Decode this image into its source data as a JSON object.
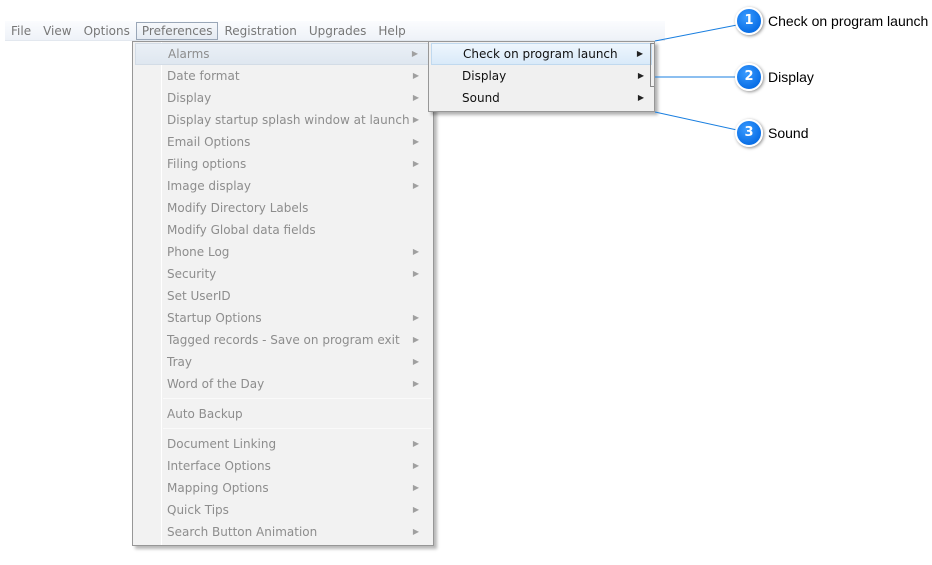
{
  "menubar": {
    "items": [
      "File",
      "View",
      "Options",
      "Preferences",
      "Registration",
      "Upgrades",
      "Help"
    ],
    "active": "Preferences"
  },
  "dropdown": {
    "groups": [
      [
        {
          "label": "Alarms",
          "submenu": true,
          "highlighted": true
        },
        {
          "label": "Date format",
          "submenu": true
        },
        {
          "label": "Display",
          "submenu": true
        },
        {
          "label": "Display startup splash window at launch",
          "submenu": true
        },
        {
          "label": "Email Options",
          "submenu": true
        },
        {
          "label": "Filing options",
          "submenu": true
        },
        {
          "label": "Image display",
          "submenu": true
        },
        {
          "label": "Modify Directory Labels",
          "submenu": false
        },
        {
          "label": "Modify Global data fields",
          "submenu": false
        },
        {
          "label": "Phone Log",
          "submenu": true
        },
        {
          "label": "Security",
          "submenu": true
        },
        {
          "label": "Set UserID",
          "submenu": false
        },
        {
          "label": "Startup Options",
          "submenu": true
        },
        {
          "label": "Tagged records - Save on program exit",
          "submenu": true
        },
        {
          "label": "Tray",
          "submenu": true
        },
        {
          "label": "Word of the Day",
          "submenu": true
        }
      ],
      [
        {
          "label": "Auto Backup",
          "submenu": false
        }
      ],
      [
        {
          "label": "Document Linking",
          "submenu": true
        },
        {
          "label": "Interface Options",
          "submenu": true
        },
        {
          "label": "Mapping Options",
          "submenu": true
        },
        {
          "label": "Quick Tips",
          "submenu": true
        },
        {
          "label": "Search Button Animation",
          "submenu": true
        }
      ]
    ]
  },
  "submenu": {
    "items": [
      {
        "label": "Check on program launch",
        "highlighted": true
      },
      {
        "label": "Display"
      },
      {
        "label": "Sound"
      }
    ]
  },
  "callouts": [
    {
      "number": "1",
      "label": "Check on program launch"
    },
    {
      "number": "2",
      "label": "Display"
    },
    {
      "number": "3",
      "label": "Sound"
    }
  ],
  "colors": {
    "callout_badge": "#0a6fe6",
    "callout_line": "#1a7fe0",
    "disabled_text": "#8d8d8d"
  }
}
